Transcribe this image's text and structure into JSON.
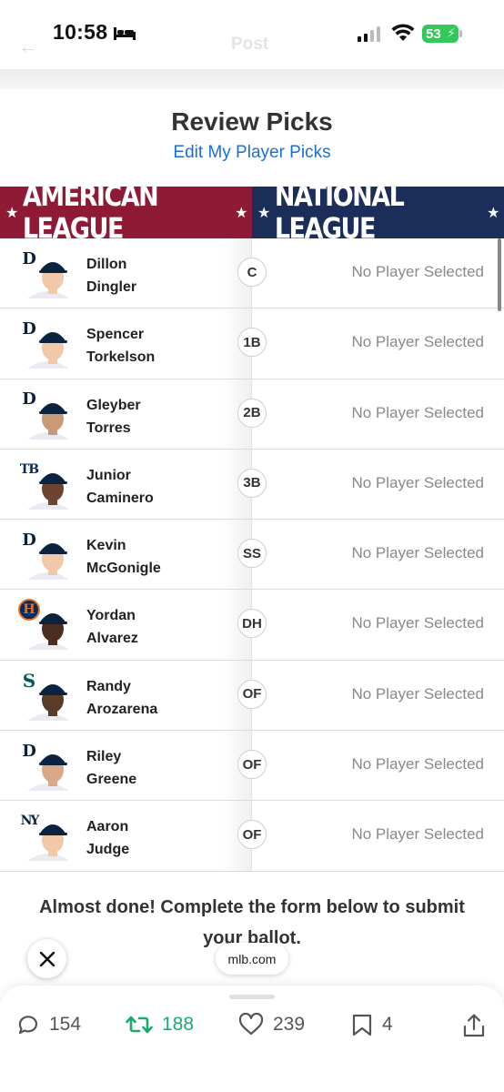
{
  "status_bar": {
    "time": "10:58",
    "battery": "53"
  },
  "ghost_header": {
    "title": "Post"
  },
  "review": {
    "title": "Review Picks",
    "edit_link": "Edit My Player Picks"
  },
  "leagues": {
    "american": "AMERICAN LEAGUE",
    "national": "NATIONAL LEAGUE"
  },
  "picks": [
    {
      "first": "Dillon",
      "last": "Dingler",
      "team": "D",
      "pos": "C",
      "nl": "No Player Selected"
    },
    {
      "first": "Spencer",
      "last": "Torkelson",
      "team": "D",
      "pos": "1B",
      "nl": "No Player Selected"
    },
    {
      "first": "Gleyber",
      "last": "Torres",
      "team": "D",
      "pos": "2B",
      "nl": "No Player Selected"
    },
    {
      "first": "Junior",
      "last": "Caminero",
      "team": "TB",
      "pos": "3B",
      "nl": "No Player Selected"
    },
    {
      "first": "Kevin",
      "last": "McGonigle",
      "team": "D",
      "pos": "SS",
      "nl": "No Player Selected"
    },
    {
      "first": "Yordan",
      "last": "Alvarez",
      "team": "H",
      "pos": "DH",
      "nl": "No Player Selected"
    },
    {
      "first": "Randy",
      "last": "Arozarena",
      "team": "S",
      "pos": "OF",
      "nl": "No Player Selected"
    },
    {
      "first": "Riley",
      "last": "Greene",
      "team": "D",
      "pos": "OF",
      "nl": "No Player Selected"
    },
    {
      "first": "Aaron",
      "last": "Judge",
      "team": "NY",
      "pos": "OF",
      "nl": "No Player Selected"
    }
  ],
  "note": "Almost done! Complete the form below to submit your ballot.",
  "link_domain": "mlb.com",
  "actions": {
    "replies": "154",
    "reposts": "188",
    "likes": "239",
    "bookmarks": "4"
  },
  "colors": {
    "al": "#8e1a35",
    "nl": "#1b2e5a",
    "link": "#1a6fd1",
    "repost": "#1aaa6e"
  }
}
